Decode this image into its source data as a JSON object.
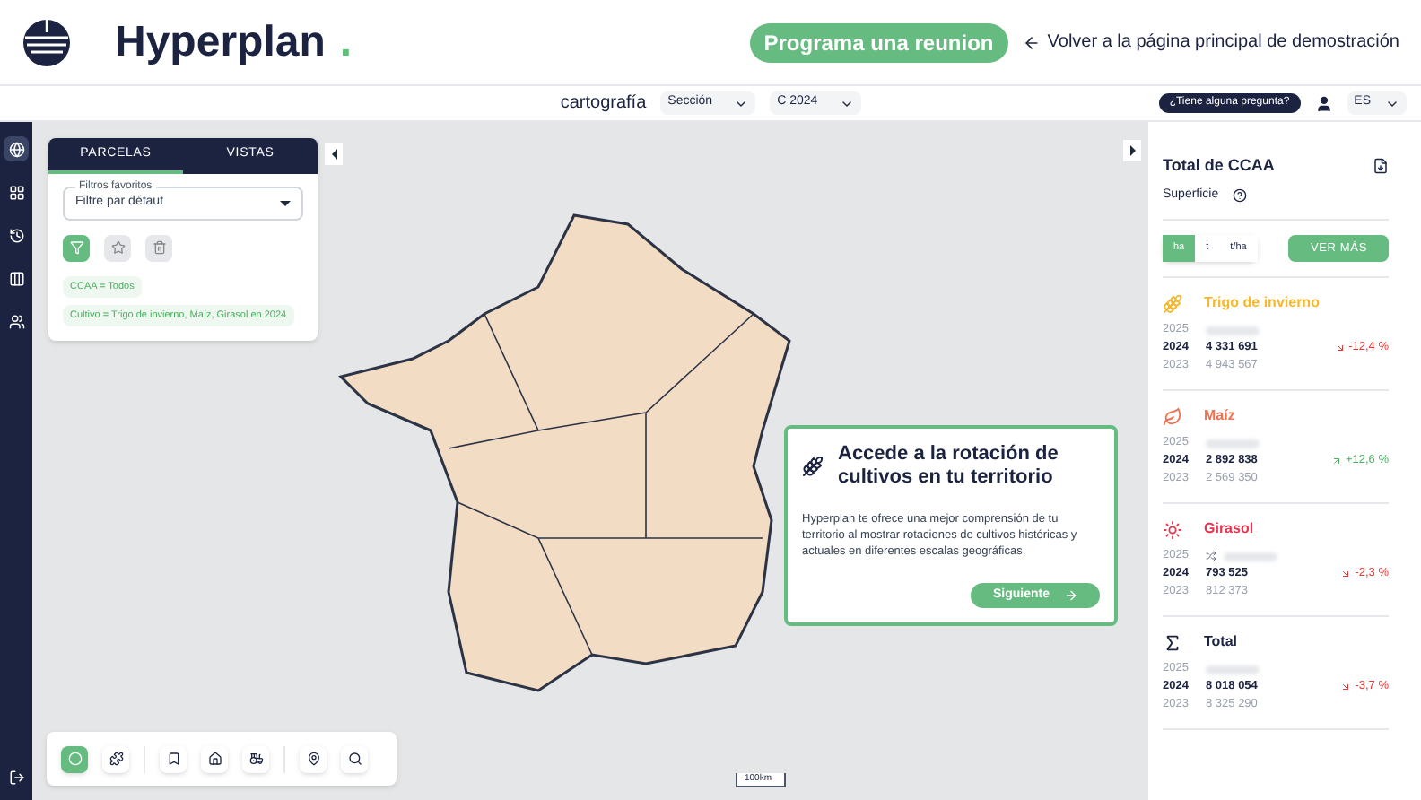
{
  "brand": {
    "name": "Hyperplan",
    "dot": "."
  },
  "header": {
    "cta": "Programa una reunion",
    "back_link": "Volver a la página principal de demostración"
  },
  "toolbar": {
    "label": "cartografía",
    "selects": [
      "Sección",
      "C 2024"
    ],
    "help": "¿Tiene alguna pregunta?",
    "language": "ES"
  },
  "sidebar": {
    "items": [
      {
        "kind": "globe",
        "selected": true
      },
      {
        "kind": "grid",
        "selected": false
      },
      {
        "kind": "history",
        "selected": false
      },
      {
        "kind": "columns",
        "selected": false
      },
      {
        "kind": "users",
        "selected": false
      }
    ]
  },
  "filter_panel": {
    "tabs": [
      {
        "label": "PARCELAS",
        "selected": true
      },
      {
        "label": "VISTAS",
        "selected": false
      }
    ],
    "favorites": {
      "label": "Filtros favoritos",
      "value": "Filtre par défaut"
    },
    "actions": [
      {
        "kind": "filter",
        "active": true
      },
      {
        "kind": "star",
        "active": false
      },
      {
        "kind": "trash",
        "active": false
      }
    ],
    "chips": [
      "CCAA = Todos",
      "Cultivo = Trigo de invierno, Maíz, Girasol en 2024"
    ]
  },
  "map_tools": [
    [
      {
        "kind": "circle",
        "active": true
      },
      {
        "kind": "puzzle",
        "active": false
      }
    ],
    [
      {
        "kind": "bookmark",
        "active": false
      },
      {
        "kind": "home",
        "active": false
      },
      {
        "kind": "tractor",
        "active": false
      }
    ],
    [
      {
        "kind": "pin",
        "active": false
      },
      {
        "kind": "search",
        "active": false
      }
    ]
  ],
  "map": {
    "scale": "100km"
  },
  "tooltip": {
    "title": "Accede a la rotación de cultivos en tu territorio",
    "body": "Hyperplan te ofrece una mejor comprensión de tu territorio al mostrar rotaciones de cultivos históricas y actuales en diferentes escalas geográficas.",
    "button": "Siguiente"
  },
  "stats": {
    "title": "Total de CCAA",
    "subtitle": "Superficie",
    "units": [
      {
        "label": "ha",
        "selected": true
      },
      {
        "label": "t",
        "selected": false
      },
      {
        "label": "t/ha",
        "selected": false
      }
    ],
    "more": "VER MÁS",
    "crops": [
      {
        "name": "Trigo de invierno",
        "kind": "wheat",
        "color": "#f5b82e",
        "rows": [
          {
            "year": "2025",
            "hidden": true,
            "current": false
          },
          {
            "year": "2024",
            "value": "4 331 691",
            "current": true,
            "change": "-12,4 %",
            "rising": false
          },
          {
            "year": "2023",
            "value": "4 943 567",
            "current": false
          }
        ]
      },
      {
        "name": "Maíz",
        "kind": "leaf",
        "color": "#f0704f",
        "rows": [
          {
            "year": "2025",
            "hidden": true,
            "current": false
          },
          {
            "year": "2024",
            "value": "2 892 838",
            "current": true,
            "change": "+12,6 %",
            "rising": true
          },
          {
            "year": "2023",
            "value": "2 569 350",
            "current": false
          }
        ]
      },
      {
        "name": "Girasol",
        "kind": "sun",
        "color": "#e8344e",
        "rows": [
          {
            "year": "2025",
            "hidden": true,
            "shuffle": true,
            "current": false
          },
          {
            "year": "2024",
            "value": "793 525",
            "current": true,
            "change": "-2,3 %",
            "rising": false
          },
          {
            "year": "2023",
            "value": "812 373",
            "current": false
          }
        ]
      },
      {
        "name": "Total",
        "kind": "sigma",
        "color": "#1b2340",
        "rows": [
          {
            "year": "2025",
            "hidden": true,
            "current": false
          },
          {
            "year": "2024",
            "value": "8 018 054",
            "current": true,
            "change": "-3,7 %",
            "rising": false
          },
          {
            "year": "2023",
            "value": "8 325 290",
            "current": false
          }
        ]
      }
    ]
  }
}
